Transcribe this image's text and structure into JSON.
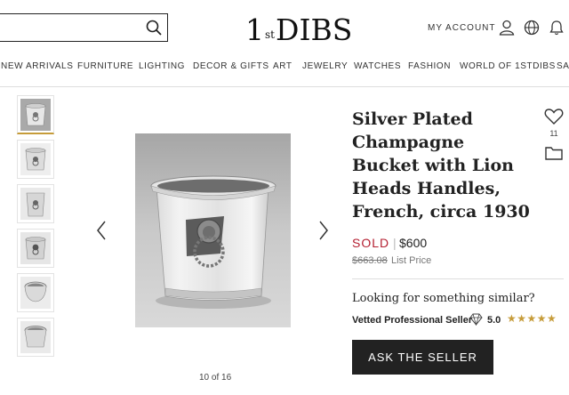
{
  "header": {
    "search": {
      "value": "",
      "placeholder": ""
    },
    "logo": {
      "digit": "1",
      "sup_top": "st",
      "sup_bottom": "",
      "name": "DIBS"
    },
    "account_label": "MY ACCOUNT",
    "icons": [
      "search-icon",
      "user-icon",
      "globe-icon",
      "bell-icon"
    ]
  },
  "nav": {
    "items": [
      "NEW ARRIVALS",
      "FURNITURE",
      "LIGHTING",
      "DECOR & GIFTS",
      "ART",
      "JEWELRY",
      "WATCHES",
      "FASHION",
      "WORLD OF 1STDIBS",
      "SAL"
    ]
  },
  "gallery": {
    "counter": "10 of 16",
    "thumbnail_count": 6,
    "selected_thumbnail": 1
  },
  "product": {
    "title": "Silver Plated Champagne Bucket with Lion Heads Handles, French, circa 1930",
    "favorites_count": "11",
    "sold_label": "SOLD",
    "price": "$600",
    "list_price": "$663.08",
    "list_price_label": "List Price",
    "similar_text": "Looking for something similar?",
    "seller_label": "Vetted Professional Seller",
    "rating": "5.0",
    "stars": "★★★★★",
    "ask_button": "ASK THE SELLER"
  },
  "colors": {
    "sold": "#b41f31",
    "stars": "#c69c3a",
    "button_bg": "#222222"
  }
}
